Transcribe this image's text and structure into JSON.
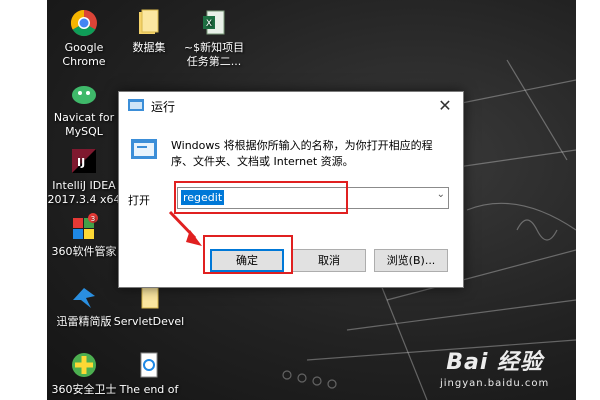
{
  "desktop_icons": [
    {
      "name": "chrome",
      "label": "Google\nChrome"
    },
    {
      "name": "folder-shujuji",
      "label": "数据集"
    },
    {
      "name": "excel-new-project",
      "label": "~$新知项目\n任务第二..."
    },
    {
      "name": "navicat",
      "label": "Navicat for\nMySQL"
    },
    {
      "name": "intellij",
      "label": "IntelliJ IDEA\n2017.3.4 x64"
    },
    {
      "name": "360-software",
      "label": "360软件管家"
    },
    {
      "name": "xunlei",
      "label": "迅雷精简版"
    },
    {
      "name": "servletdevel",
      "label": "ServletDevel"
    },
    {
      "name": "360-safe",
      "label": "360安全卫士"
    },
    {
      "name": "the-end-of",
      "label": "The end of"
    }
  ],
  "run_dialog": {
    "title": "运行",
    "description": "Windows 将根据你所输入的名称，为你打开相应的程序、文件夹、文档或 Internet 资源。",
    "open_label": "打开",
    "input_value": "regedit",
    "buttons": {
      "ok": "确定",
      "cancel": "取消",
      "browse": "浏览(B)..."
    }
  },
  "watermark": {
    "brand": "Bai 经验",
    "sub": "jingyan.baidu.com"
  },
  "colors": {
    "highlight": "#e02020",
    "selection": "#0078d7"
  }
}
